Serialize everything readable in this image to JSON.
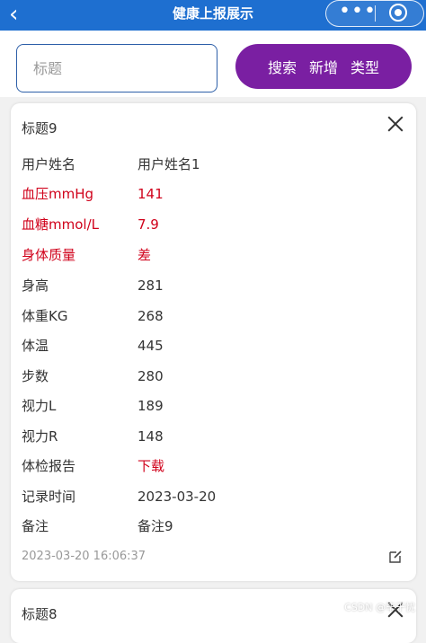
{
  "header": {
    "back_icon": "chevron-left-icon",
    "title": "健康上报展示",
    "more_icon": "more-dots-icon",
    "close_mini_icon": "target-circle-icon"
  },
  "search": {
    "placeholder": "标题",
    "actions": [
      "搜索",
      "新增",
      "类型"
    ],
    "pill_color": "#7a1fa2"
  },
  "cards": [
    {
      "title": "标题9",
      "fields": [
        {
          "label": "用户姓名",
          "value": "用户姓名1",
          "highlight": false
        },
        {
          "label": "血压mmHg",
          "value": "141",
          "highlight": true
        },
        {
          "label": "血糖mmol/L",
          "value": "7.9",
          "highlight": true
        },
        {
          "label": "身体质量",
          "value": "差",
          "highlight": true
        },
        {
          "label": "身高",
          "value": "281",
          "highlight": false
        },
        {
          "label": "体重KG",
          "value": "268",
          "highlight": false
        },
        {
          "label": "体温",
          "value": "445",
          "highlight": false
        },
        {
          "label": "步数",
          "value": "280",
          "highlight": false
        },
        {
          "label": "视力L",
          "value": "189",
          "highlight": false
        },
        {
          "label": "视力R",
          "value": "148",
          "highlight": false
        },
        {
          "label": "体检报告",
          "value": "下载",
          "highlight": false,
          "value_red": true
        },
        {
          "label": "记录时间",
          "value": "2023-03-20",
          "highlight": false
        },
        {
          "label": "备注",
          "value": "备注9",
          "highlight": false
        }
      ],
      "timestamp": "2023-03-20 16:06:37"
    },
    {
      "title": "标题8"
    }
  ],
  "watermark": "CSDN @毕于忧",
  "colors": {
    "header": "#1e6fd0",
    "highlight_red": "#d0021b"
  }
}
